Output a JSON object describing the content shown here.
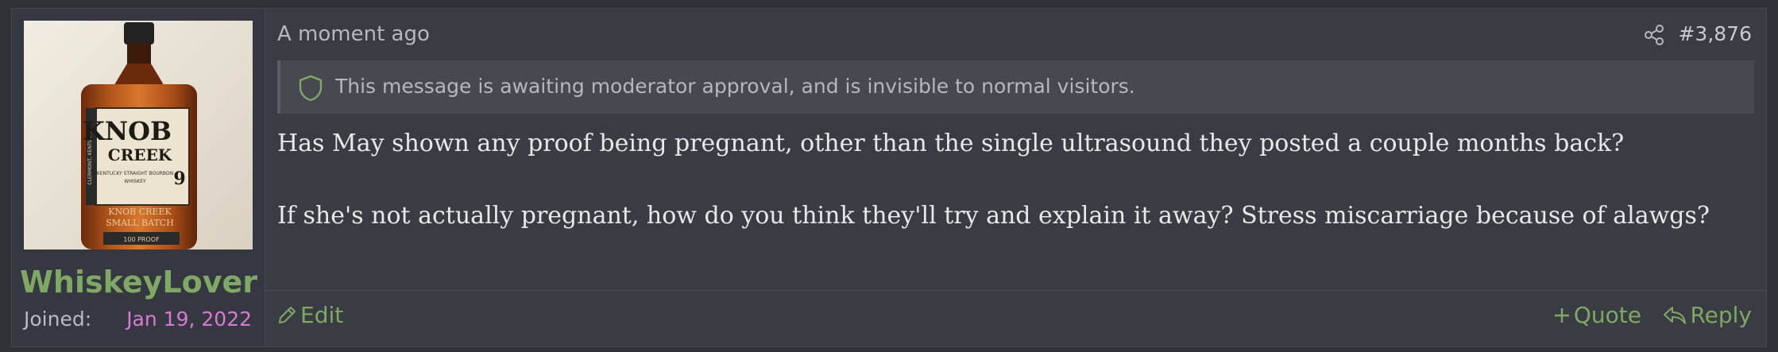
{
  "post": {
    "author": {
      "username": "WhiskeyLover",
      "joined_label": "Joined:",
      "joined_date": "Jan 19, 2022",
      "avatar": "Knob Creek bourbon bottle photo"
    },
    "timestamp": "A moment ago",
    "post_number": "#3,876",
    "moderation_notice": "This message is awaiting moderator approval, and is invisible to normal visitors.",
    "body": [
      "Has May shown any proof being pregnant, other than the single ultrasound they posted a couple months back?",
      "If she's not actually pregnant, how do you think they'll try and explain it away? Stress miscarriage because of alawgs?"
    ],
    "actions": {
      "edit": "Edit",
      "quote": "Quote",
      "reply": "Reply"
    }
  },
  "avatar_label": {
    "brand_line1": "KNOB",
    "brand_line2": "CREEK",
    "side_text": "CLERMONT, KENTUCKY",
    "sub_text1": "KENTUCKY STRAIGHT BOURBON",
    "sub_text2": "WHISKEY",
    "age": "9",
    "lower1": "KNOB CREEK",
    "lower2": "SMALL BATCH",
    "proof": "100 PROOF"
  },
  "colors": {
    "accent_green": "#7fa864",
    "joined_date_pink": "#d77ad1",
    "panel_bg": "#393c42"
  }
}
